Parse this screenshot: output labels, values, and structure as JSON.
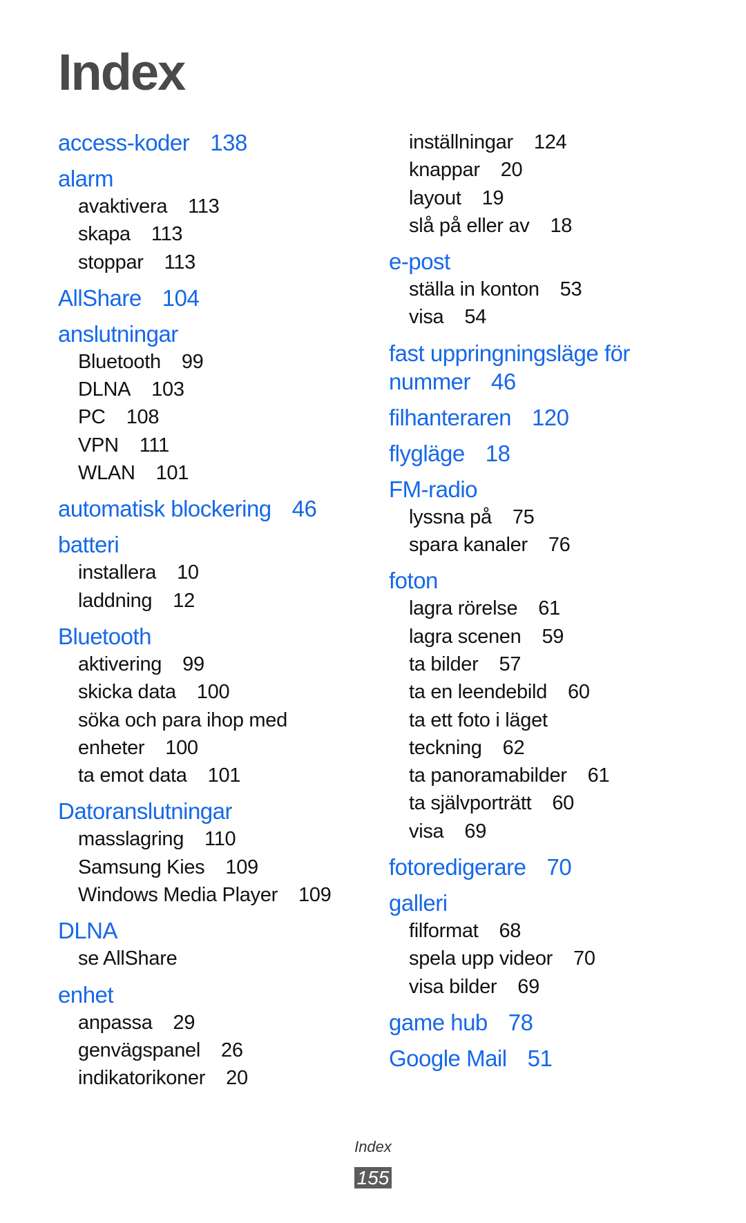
{
  "page_title": "Index",
  "footer": {
    "section_label": "Index",
    "page_number": "155"
  },
  "accent_color": "#1668e8",
  "left_column": [
    {
      "type": "main",
      "term": "access-koder",
      "page": "138"
    },
    {
      "type": "main",
      "term": "alarm",
      "page": ""
    },
    {
      "type": "sub",
      "term": "avaktivera",
      "page": "113"
    },
    {
      "type": "sub",
      "term": "skapa",
      "page": "113"
    },
    {
      "type": "sub",
      "term": "stoppar",
      "page": "113"
    },
    {
      "type": "main",
      "term": "AllShare",
      "page": "104"
    },
    {
      "type": "main",
      "term": "anslutningar",
      "page": ""
    },
    {
      "type": "sub",
      "term": "Bluetooth",
      "page": "99"
    },
    {
      "type": "sub",
      "term": "DLNA",
      "page": "103"
    },
    {
      "type": "sub",
      "term": "PC",
      "page": "108"
    },
    {
      "type": "sub",
      "term": "VPN",
      "page": "111"
    },
    {
      "type": "sub",
      "term": "WLAN",
      "page": "101"
    },
    {
      "type": "main",
      "term": "automatisk blockering",
      "page": "46"
    },
    {
      "type": "main",
      "term": "batteri",
      "page": ""
    },
    {
      "type": "sub",
      "term": "installera",
      "page": "10"
    },
    {
      "type": "sub",
      "term": "laddning",
      "page": "12"
    },
    {
      "type": "main",
      "term": "Bluetooth",
      "page": ""
    },
    {
      "type": "sub",
      "term": "aktivering",
      "page": "99"
    },
    {
      "type": "sub",
      "term": "skicka data",
      "page": "100"
    },
    {
      "type": "sub",
      "term": "söka och para ihop med",
      "page": ""
    },
    {
      "type": "sub",
      "term": "enheter",
      "page": "100"
    },
    {
      "type": "sub",
      "term": "ta emot data",
      "page": "101"
    },
    {
      "type": "main",
      "term": "Datoranslutningar",
      "page": ""
    },
    {
      "type": "sub",
      "term": "masslagring",
      "page": "110"
    },
    {
      "type": "sub",
      "term": "Samsung Kies",
      "page": "109"
    },
    {
      "type": "sub",
      "term": "Windows Media Player",
      "page": "109"
    },
    {
      "type": "main",
      "term": "DLNA",
      "page": ""
    },
    {
      "type": "sub",
      "term": "se AllShare",
      "page": ""
    },
    {
      "type": "main",
      "term": "enhet",
      "page": ""
    },
    {
      "type": "sub",
      "term": "anpassa",
      "page": "29"
    },
    {
      "type": "sub",
      "term": "genvägspanel",
      "page": "26"
    },
    {
      "type": "sub",
      "term": "indikatorikoner",
      "page": "20"
    }
  ],
  "right_column": [
    {
      "type": "sub",
      "term": "inställningar",
      "page": "124"
    },
    {
      "type": "sub",
      "term": "knappar",
      "page": "20"
    },
    {
      "type": "sub",
      "term": "layout",
      "page": "19"
    },
    {
      "type": "sub",
      "term": "slå på eller av",
      "page": "18"
    },
    {
      "type": "main",
      "term": "e-post",
      "page": ""
    },
    {
      "type": "sub",
      "term": "ställa in konton",
      "page": "53"
    },
    {
      "type": "sub",
      "term": "visa",
      "page": "54"
    },
    {
      "type": "main",
      "term": "fast uppringningsläge för",
      "page": ""
    },
    {
      "type": "main-cont",
      "term": "nummer",
      "page": "46"
    },
    {
      "type": "main",
      "term": "filhanteraren",
      "page": "120"
    },
    {
      "type": "main",
      "term": "flygläge",
      "page": "18"
    },
    {
      "type": "main",
      "term": "FM-radio",
      "page": ""
    },
    {
      "type": "sub",
      "term": "lyssna på",
      "page": "75"
    },
    {
      "type": "sub",
      "term": "spara kanaler",
      "page": "76"
    },
    {
      "type": "main",
      "term": "foton",
      "page": ""
    },
    {
      "type": "sub",
      "term": "lagra rörelse",
      "page": "61"
    },
    {
      "type": "sub",
      "term": "lagra scenen",
      "page": "59"
    },
    {
      "type": "sub",
      "term": "ta bilder",
      "page": "57"
    },
    {
      "type": "sub",
      "term": "ta en leendebild",
      "page": "60"
    },
    {
      "type": "sub",
      "term": "ta ett foto i läget",
      "page": ""
    },
    {
      "type": "sub",
      "term": "teckning",
      "page": "62"
    },
    {
      "type": "sub",
      "term": "ta panoramabilder",
      "page": "61"
    },
    {
      "type": "sub",
      "term": "ta självporträtt",
      "page": "60"
    },
    {
      "type": "sub",
      "term": "visa",
      "page": "69"
    },
    {
      "type": "main",
      "term": "fotoredigerare",
      "page": "70"
    },
    {
      "type": "main",
      "term": "galleri",
      "page": ""
    },
    {
      "type": "sub",
      "term": "filformat",
      "page": "68"
    },
    {
      "type": "sub",
      "term": "spela upp videor",
      "page": "70"
    },
    {
      "type": "sub",
      "term": "visa bilder",
      "page": "69"
    },
    {
      "type": "main",
      "term": "game hub",
      "page": "78"
    },
    {
      "type": "main",
      "term": "Google Mail",
      "page": "51"
    }
  ]
}
